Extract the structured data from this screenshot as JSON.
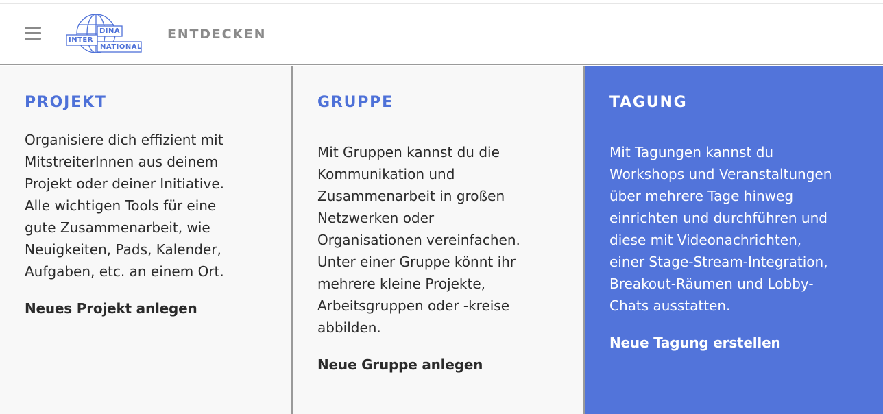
{
  "header": {
    "menu_icon": "hamburger-menu-icon",
    "logo": {
      "top": "DINA",
      "left": "INTER",
      "bottom": "NATIONAL"
    },
    "nav_label": "ENTDECKEN"
  },
  "colors": {
    "accent": "#5274DA",
    "title_blue": "#4E71D8",
    "text": "#2B2B2B",
    "muted": "#8A8A8A",
    "card_bg": "#F8F8F8"
  },
  "cards": [
    {
      "title": "PROJEKT",
      "lines": [
        "Organisiere dich effizient mit",
        "MitstreiterInnen aus deinem",
        "Projekt oder deiner Initiative.",
        "Alle wichtigen Tools für eine",
        "gute Zusammenarbeit, wie",
        "Neuigkeiten, Pads, Kalender,",
        "Aufgaben, etc. an einem Ort."
      ],
      "action": "Neues Projekt anlegen"
    },
    {
      "title": "GRUPPE",
      "lines": [
        "Mit Gruppen kannst du die",
        "Kommunikation und",
        "Zusammenarbeit in großen",
        "Netzwerken oder",
        "Organisationen vereinfachen.",
        "Unter einer Gruppe könnt ihr",
        "mehrere kleine Projekte,",
        "Arbeitsgruppen oder -kreise",
        "abbilden."
      ],
      "action": "Neue Gruppe anlegen"
    },
    {
      "title": "TAGUNG",
      "lines": [
        "Mit Tagungen kannst du",
        "Workshops und Veranstaltungen",
        "über mehrere Tage hinweg",
        "einrichten und durchführen und",
        "diese mit Videonachrichten,",
        "einer Stage-Stream-Integration,",
        "Breakout-Räumen und Lobby-",
        "Chats ausstatten."
      ],
      "action": "Neue Tagung erstellen"
    }
  ]
}
